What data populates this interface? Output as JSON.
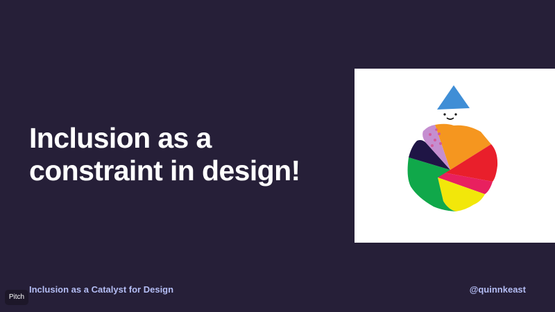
{
  "slide": {
    "title_line1": "Inclusion as a",
    "title_line2": "constraint in design!",
    "footer_title": "Inclusion as a Catalyst for Design",
    "footer_handle": "@quinnkeast",
    "brand": "Pitch"
  },
  "colors": {
    "background": "#261f38",
    "title": "#ffffff",
    "footer": "#b4bdf4"
  },
  "illustration": {
    "icon": "colorful-round-character-illustration"
  }
}
